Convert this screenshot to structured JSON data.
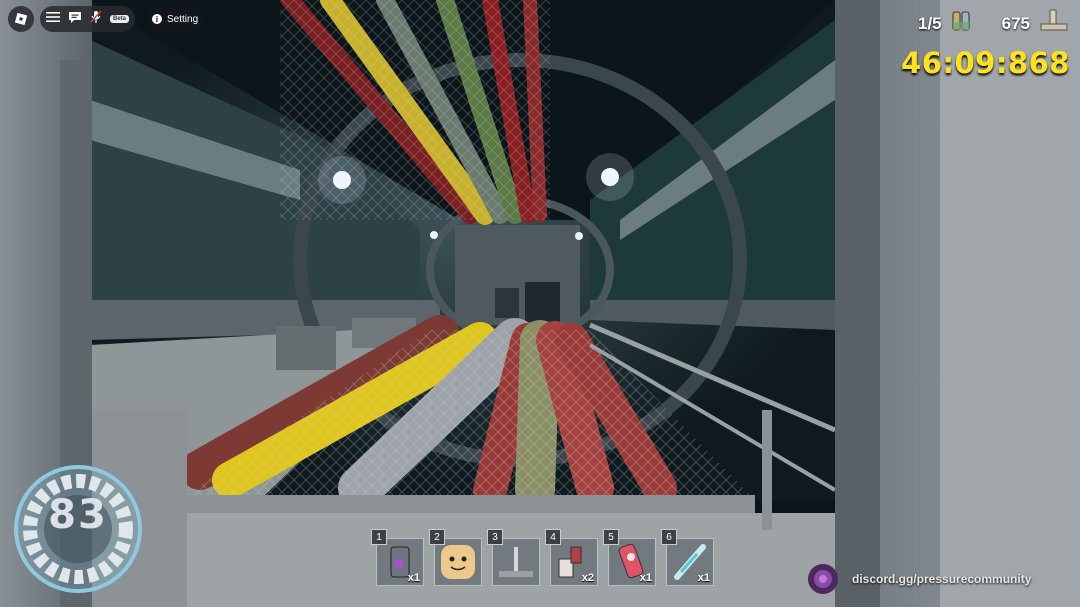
{
  "topbar": {
    "menu_icon": "hamburger-menu-icon",
    "chat_icon": "chat-bubble-icon",
    "mic_icon": "microphone-muted-icon",
    "beta_label": "Beta",
    "setting_label": "Setting"
  },
  "hud": {
    "keycards": "1/5",
    "currency": "675",
    "timer": "46:09:868"
  },
  "stamina": {
    "value": "83"
  },
  "hotbar": [
    {
      "num": "1",
      "count": "x1",
      "item": "flashlight-icon"
    },
    {
      "num": "2",
      "count": "",
      "item": "face-block-icon"
    },
    {
      "num": "3",
      "count": "",
      "item": "lever-icon"
    },
    {
      "num": "4",
      "count": "x2",
      "item": "battery-pack-icon"
    },
    {
      "num": "5",
      "count": "x1",
      "item": "handheld-device-icon"
    },
    {
      "num": "6",
      "count": "x1",
      "item": "syringe-icon"
    }
  ],
  "footer": {
    "discord": "discord.gg/pressurecommunity"
  },
  "colors": {
    "timer": "#ffe21a"
  }
}
